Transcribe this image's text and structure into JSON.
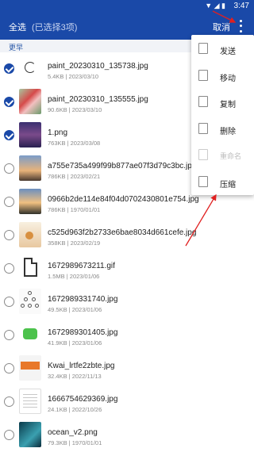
{
  "status_bar": {
    "time": "3:47",
    "icons": "▼ ◢ ▮"
  },
  "app_bar": {
    "select_all": "全选",
    "selection_count": "(已选择3项)",
    "cancel": "取消"
  },
  "section_header": "更早",
  "files": [
    {
      "name": "paint_20230310_135738.jpg",
      "meta": "5.4KB | 2023/03/10",
      "checked": true,
      "thumb": "spiral"
    },
    {
      "name": "paint_20230310_135555.jpg",
      "meta": "90.6KB | 2023/03/10",
      "checked": true,
      "thumb": "flowers"
    },
    {
      "name": "1.png",
      "meta": "763KB | 2023/03/08",
      "checked": true,
      "thumb": "night"
    },
    {
      "name": "a755e735a499f99b877ae07f3d79c3bc.jpg",
      "meta": "786KB | 2023/02/21",
      "checked": false,
      "thumb": "sunset1"
    },
    {
      "name": "0966b2de114e84f04d0702430801e754.jpg",
      "meta": "786KB | 1970/01/01",
      "checked": false,
      "thumb": "sunset2"
    },
    {
      "name": "c525d963f2b2733e6bae8034d661cefe.jpg",
      "meta": "358KB | 2023/02/19",
      "checked": false,
      "thumb": "warm"
    },
    {
      "name": "1672989673211.gif",
      "meta": "1.5MB | 2023/01/06",
      "checked": false,
      "thumb": "gif"
    },
    {
      "name": "1672989331740.jpg",
      "meta": "49.5KB | 2023/01/06",
      "checked": false,
      "thumb": "cartoon"
    },
    {
      "name": "1672989301405.jpg",
      "meta": "41.9KB | 2023/01/06",
      "checked": false,
      "thumb": "green"
    },
    {
      "name": "Kwai_lrtfe2zbte.jpg",
      "meta": "32.4KB | 2022/11/13",
      "checked": false,
      "thumb": "orange"
    },
    {
      "name": "1666754629369.jpg",
      "meta": "24.1KB | 2022/10/26",
      "checked": false,
      "thumb": "doc"
    },
    {
      "name": "ocean_v2.png",
      "meta": "79.3KB | 1970/01/01",
      "checked": false,
      "thumb": "ocean"
    }
  ],
  "menu": [
    {
      "label": "发送",
      "icon": "send-icon",
      "enabled": true
    },
    {
      "label": "移动",
      "icon": "move-icon",
      "enabled": true
    },
    {
      "label": "复制",
      "icon": "copy-icon",
      "enabled": true
    },
    {
      "label": "删除",
      "icon": "trash-icon",
      "enabled": true
    },
    {
      "label": "重命名",
      "icon": "rename-icon",
      "enabled": false
    },
    {
      "label": "压缩",
      "icon": "compress-icon",
      "enabled": true
    }
  ],
  "colors": {
    "app_bar": "#1a49a8",
    "annotation_arrow": "#e02020"
  }
}
